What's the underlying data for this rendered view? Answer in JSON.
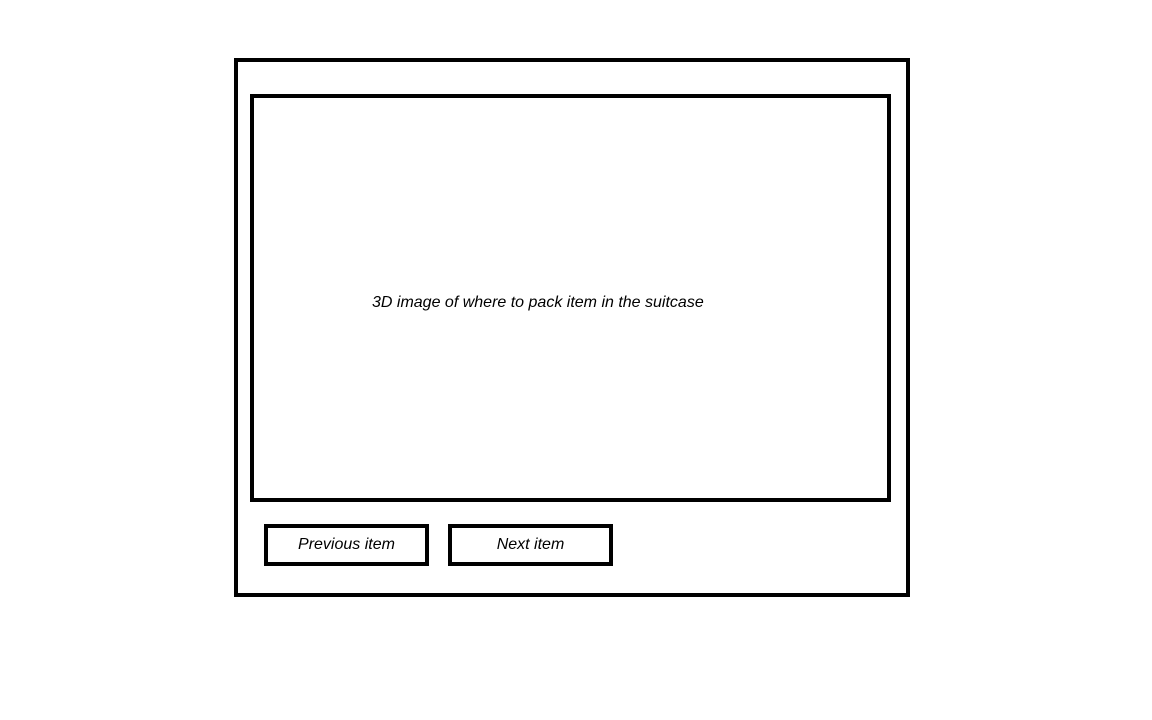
{
  "viewer": {
    "caption": "3D image of where to pack item in the suitcase"
  },
  "navigation": {
    "previous_label": "Previous item",
    "next_label": "Next item"
  }
}
